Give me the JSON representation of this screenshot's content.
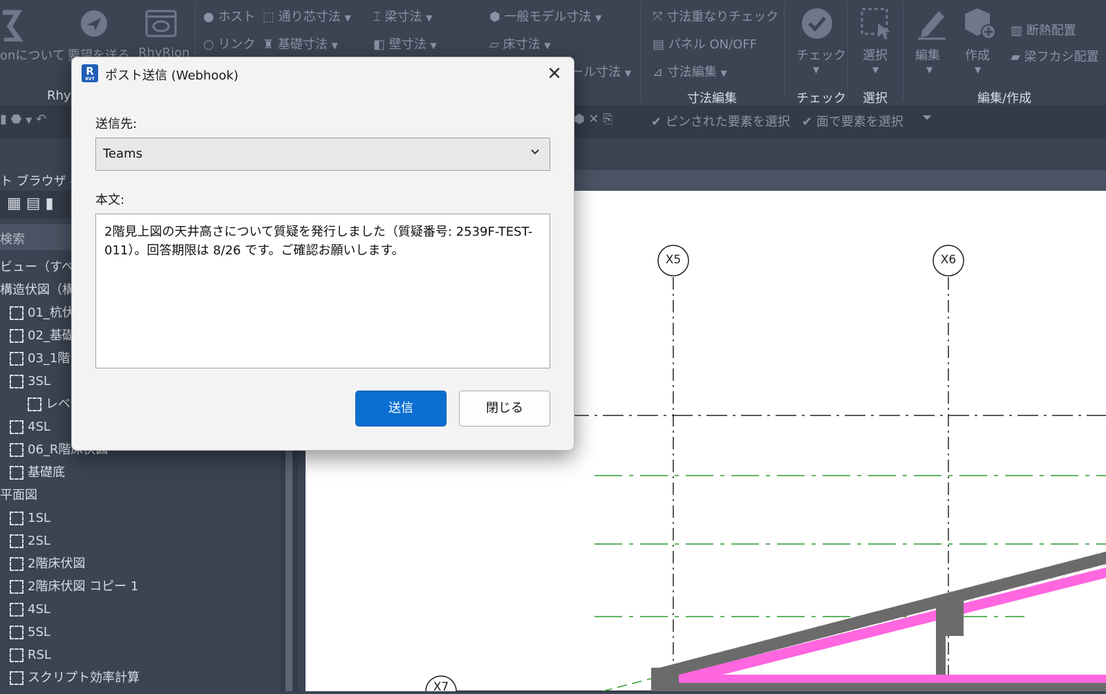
{
  "ribbon": {
    "left_labels": [
      "onについて",
      "要望を送る",
      "RhyRion",
      "Rhy"
    ],
    "row1": [
      "ホスト",
      "通り芯寸法",
      "梁寸法",
      "一般モデル寸法",
      "寸法重なりチェック"
    ],
    "row2": [
      "リンク",
      "基礎寸法",
      "壁寸法",
      "床寸法",
      "パネル ON/OFF"
    ],
    "row3": [
      "ール寸法",
      "寸法編集"
    ],
    "big_buttons": [
      "チェック",
      "選択",
      "編集",
      "作成"
    ],
    "right_items": [
      "断熱配置",
      "梁フカシ配置"
    ],
    "panel_labels": [
      "寸法編集",
      "チェック",
      "選択",
      "編集/作成"
    ]
  },
  "qat": {
    "pinned_select": "ピンされた要素を選択",
    "face_select": "面で要素を選択"
  },
  "browser": {
    "title": "ト ブラウザ - t",
    "search": "検索",
    "views": "ビュー（すべ",
    "structure": "構造伏図（構",
    "items": [
      "01_杭伏",
      "02_基礎",
      "03_1階",
      "3SL",
      "レベ",
      "4SL",
      "06_R階床伏図",
      "基礎底"
    ],
    "plan_header": "平面図",
    "plan_items": [
      "1SL",
      "2SL",
      "2階床伏図",
      "2階床伏図 コピー 1",
      "4SL",
      "5SL",
      "RSL",
      "スクリプト効率計算"
    ]
  },
  "canvas": {
    "grid_labels": [
      "X5",
      "X6",
      "X7"
    ]
  },
  "dialog": {
    "icon_letter": "R",
    "icon_sub": "RVT",
    "title": "ポスト送信 (Webhook)",
    "dest_label": "送信先:",
    "dest_value": "Teams",
    "body_label": "本文:",
    "body_text": "2階見上図の天井高さについて質疑を発行しました（質疑番号: 2539F-TEST-011）。回答期限は 8/26 です。ご確認お願いします。",
    "send_button": "送信",
    "close_button": "閉じる"
  }
}
